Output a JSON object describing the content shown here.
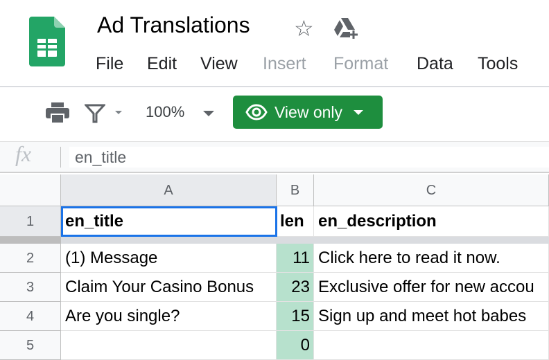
{
  "app": {
    "title": "Ad Translations",
    "icon": "google-sheets-icon",
    "accent": "#1e8e3e"
  },
  "menu": [
    {
      "label": "File",
      "enabled": true
    },
    {
      "label": "Edit",
      "enabled": true
    },
    {
      "label": "View",
      "enabled": true
    },
    {
      "label": "Insert",
      "enabled": false
    },
    {
      "label": "Format",
      "enabled": false
    },
    {
      "label": "Data",
      "enabled": true
    },
    {
      "label": "Tools",
      "enabled": true
    }
  ],
  "toolbar": {
    "zoom": "100%",
    "view_only_label": "View only"
  },
  "formula_bar": {
    "fx": "fx",
    "value": "en_title"
  },
  "columns": [
    "A",
    "B",
    "C"
  ],
  "rows": [
    {
      "n": "1",
      "a": "en_title",
      "b": "len",
      "c": "en_description"
    },
    {
      "n": "2",
      "a": "(1) Message",
      "b": "11",
      "c": "Click here to read it now."
    },
    {
      "n": "3",
      "a": "Claim Your Casino Bonus",
      "b": "23",
      "c": "Exclusive offer for new accou"
    },
    {
      "n": "4",
      "a": "Are you single?",
      "b": "15",
      "c": "Sign up and meet hot babes"
    },
    {
      "n": "5",
      "a": "",
      "b": "0",
      "c": ""
    }
  ],
  "selected_cell": "A1"
}
